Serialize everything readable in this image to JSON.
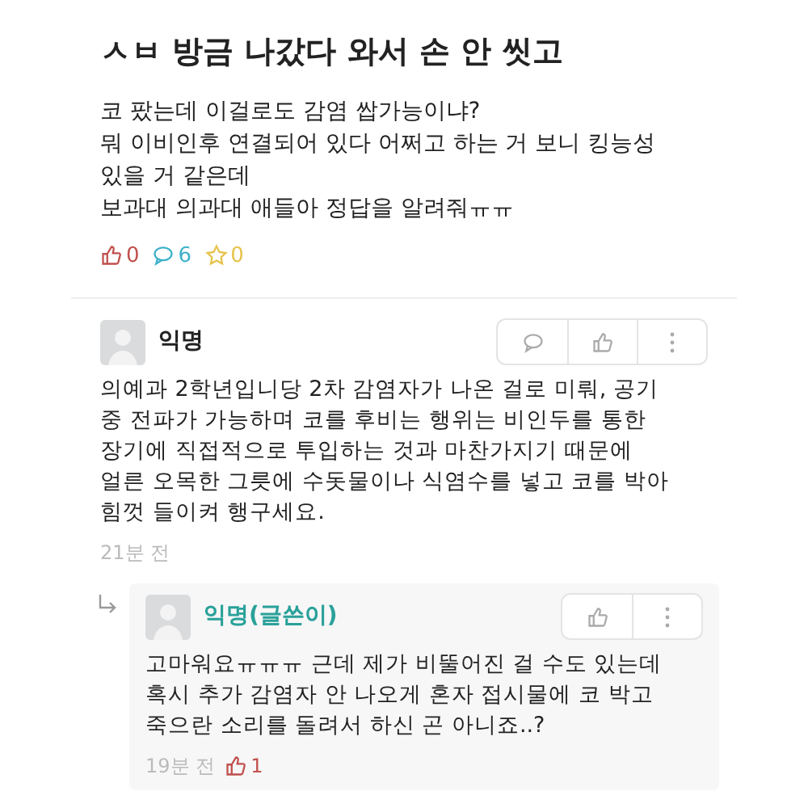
{
  "post": {
    "title": "ㅅㅂ 방금 나갔다 와서 손 안 씻고",
    "body_lines": [
      "코 팠는데 이걸로도 감염 쌉가능이냐?",
      "뭐 이비인후 연결되어 있다 어쩌고 하는 거 보니 킹능성",
      "있을 거 같은데",
      "보과대 의과대 애들아 정답을 알려줘ㅠㅠ"
    ],
    "stats": [
      {
        "kind": "like",
        "count": "0",
        "color": "#c0504d"
      },
      {
        "kind": "comment",
        "count": "6",
        "color": "#3bb0c9"
      },
      {
        "kind": "scrap",
        "count": "0",
        "color": "#e6c34a"
      }
    ]
  },
  "comments": [
    {
      "author": "익명",
      "is_writer": false,
      "actions": [
        {
          "kind": "comment"
        },
        {
          "kind": "like"
        },
        {
          "kind": "more"
        }
      ],
      "body_lines": [
        "의예과 2학년입니당 2차 감염자가 나온 걸로 미뤄, 공기",
        "중 전파가 가능하며 코를 후비는 행위는 비인두를 통한",
        "장기에 직접적으로 투입하는 것과 마찬가지기 때문에",
        "얼른 오목한 그릇에 수돗물이나 식염수를 넣고 코를 박아",
        "힘껏 들이켜 행구세요."
      ],
      "time": "21분 전",
      "replies": [
        {
          "author": "익명(글쓴이)",
          "is_writer": true,
          "actions": [
            {
              "kind": "like"
            },
            {
              "kind": "more"
            }
          ],
          "body_lines": [
            "고마워요ㅠㅠㅠ 근데 제가 비뚤어진 걸 수도 있는데",
            "혹시 추가 감염자 안 나오게 혼자 접시물에 코 박고",
            "죽으란 소리를 돌려서 하신 곤 아니죠..?"
          ],
          "time": "19분 전",
          "likes": "1"
        }
      ]
    }
  ]
}
